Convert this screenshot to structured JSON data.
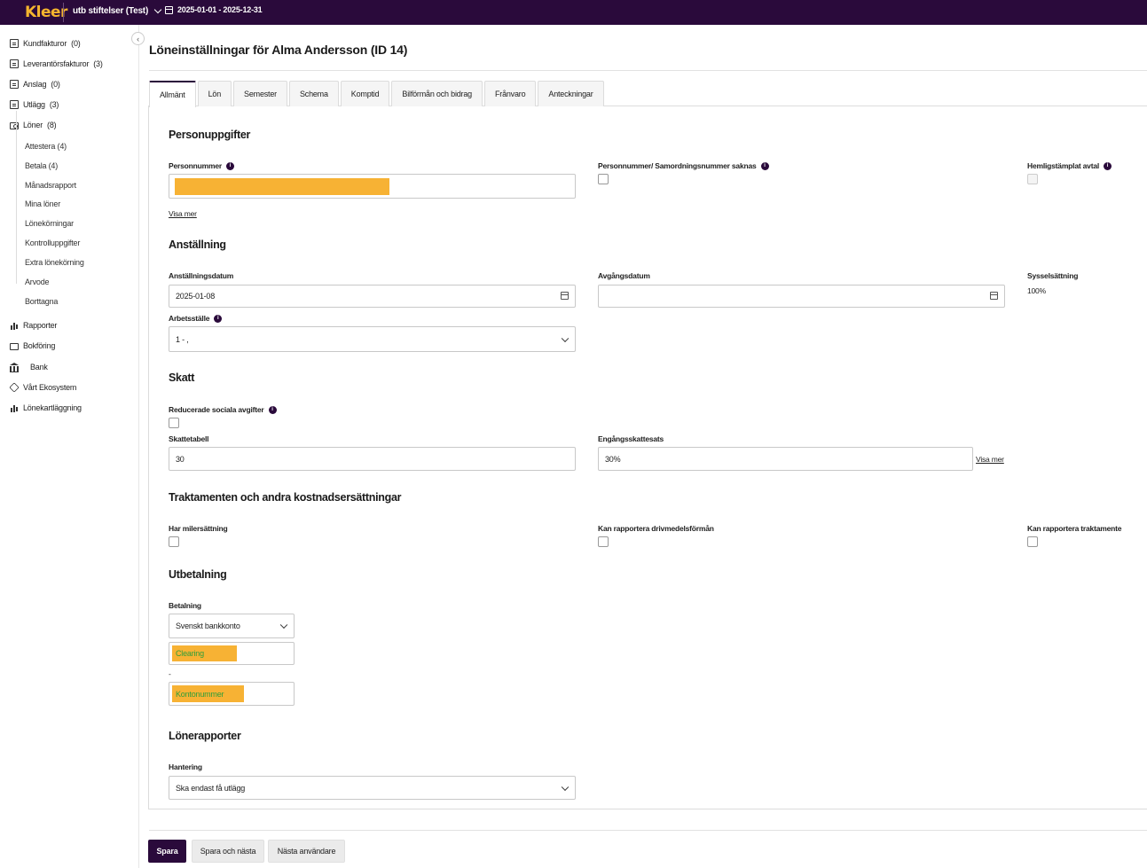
{
  "topbar": {
    "logo": "Kleer",
    "company": "utb stiftelser (Test)",
    "period": "2025-01-01 - 2025-12-31"
  },
  "sidebar": {
    "items": [
      {
        "label": "Kundfakturor",
        "count": "(0)",
        "icon": "invoice-icon"
      },
      {
        "label": "Leverantörsfakturor",
        "count": "(3)",
        "icon": "supplier-invoice-icon"
      },
      {
        "label": "Anslag",
        "count": "(0)",
        "icon": "grant-icon"
      },
      {
        "label": "Utlägg",
        "count": "(3)",
        "icon": "expense-icon"
      },
      {
        "label": "Löner",
        "count": "(8)",
        "icon": "salary-icon"
      }
    ],
    "sub_items": [
      "Attestera (4)",
      "Betala (4)",
      "Månadsrapport",
      "Mina löner",
      "Lönekörningar",
      "Kontrolluppgifter",
      "Extra lönekörning",
      "Arvode",
      "Borttagna"
    ],
    "bottom_items": [
      {
        "label": "Rapporter",
        "icon": "chart-icon"
      },
      {
        "label": "Bokföring",
        "icon": "folder-icon"
      },
      {
        "label": "Bank",
        "icon": "bank-icon"
      },
      {
        "label": "Vårt Ekosystem",
        "icon": "ecosystem-icon"
      },
      {
        "label": "Lönekartläggning",
        "icon": "chart-icon"
      }
    ]
  },
  "page": {
    "title": "Löneinställningar för Alma Andersson (ID 14)"
  },
  "tabs": [
    "Allmänt",
    "Lön",
    "Semester",
    "Schema",
    "Komptid",
    "Bilförmån och bidrag",
    "Frånvaro",
    "Anteckningar"
  ],
  "personal": {
    "title": "Personuppgifter",
    "personnummer_label": "Personnummer",
    "saknas_label": "Personnummer/ Samordningsnummer saknas",
    "secret_label": "Hemligstämplat avtal",
    "show_more": "Visa mer"
  },
  "employment": {
    "title": "Anställning",
    "start_label": "Anställningsdatum",
    "start_value": "2025-01-08",
    "end_label": "Avgångsdatum",
    "end_value": "",
    "occupation_label": "Sysselsättning",
    "occupation_value": "100%",
    "workplace_label": "Arbetsställe",
    "workplace_value": "1 - ,"
  },
  "tax": {
    "title": "Skatt",
    "reduced_label": "Reducerade sociala avgifter",
    "table_label": "Skattetabell",
    "table_value": "30",
    "onetime_label": "Engångsskattesats",
    "onetime_value": "30%",
    "show_more": "Visa mer"
  },
  "allowances": {
    "title": "Traktamenten och andra kostnadsersättningar",
    "mileage_label": "Har milersättning",
    "fuel_label": "Kan rapportera drivmedelsförmån",
    "per_diem_label": "Kan rapportera traktamente"
  },
  "payout": {
    "title": "Utbetalning",
    "payment_label": "Betalning",
    "payment_value": "Svenskt bankkonto",
    "clearing_placeholder": "Clearing",
    "separator": "-",
    "account_placeholder": "Kontonummer"
  },
  "reports": {
    "title": "Lönerapporter",
    "handling_label": "Hantering",
    "handling_value": "Ska endast få utlägg"
  },
  "footer": {
    "save": "Spara",
    "save_next": "Spara och nästa",
    "next_user": "Nästa användare"
  },
  "colors": {
    "brand_dark": "#2a0a3b",
    "brand_accent": "#f5b52e",
    "redaction": "#f7b234"
  }
}
